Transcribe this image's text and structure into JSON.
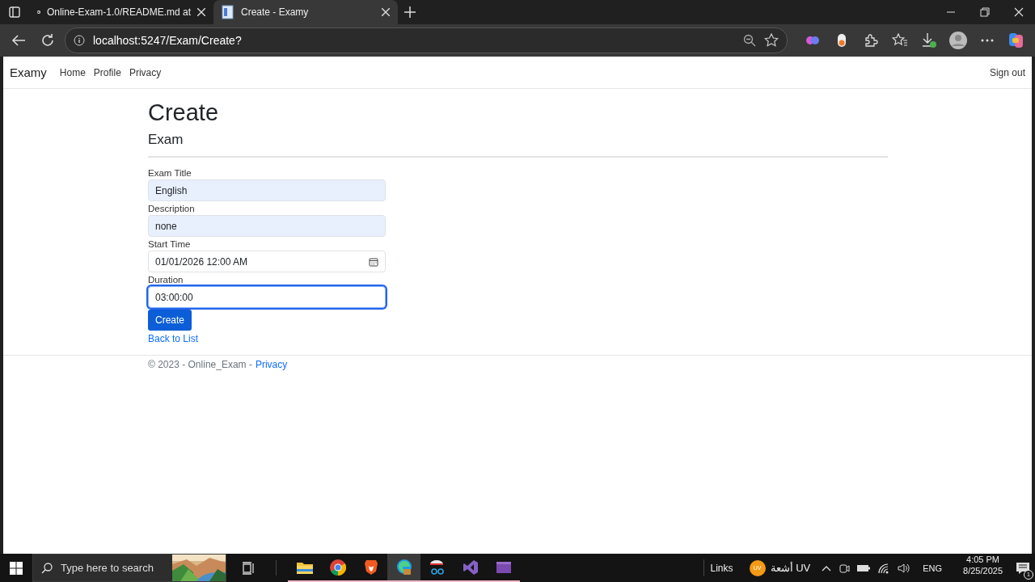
{
  "browser": {
    "tabs": [
      {
        "title": "Online-Exam-1.0/README.md at",
        "selected": false
      },
      {
        "title": "Create - Examy",
        "selected": true
      }
    ],
    "address": "localhost:5247/Exam/Create?"
  },
  "navbar": {
    "brand": "Examy",
    "links": [
      {
        "label": "Home"
      },
      {
        "label": "Profile"
      },
      {
        "label": "Privacy"
      }
    ],
    "sign_out": "Sign out"
  },
  "page": {
    "title": "Create",
    "subtitle": "Exam",
    "fields": [
      {
        "label": "Exam Title",
        "value": "English",
        "kind": "text",
        "autofilled": true,
        "focused": false
      },
      {
        "label": "Description",
        "value": "none",
        "kind": "text",
        "autofilled": true,
        "focused": false
      },
      {
        "label": "Start Time",
        "value": "01/01/2026 12:00  AM",
        "kind": "datetime",
        "autofilled": false,
        "focused": false
      },
      {
        "label": "Duration",
        "value": "03:00:00",
        "kind": "text",
        "autofilled": false,
        "focused": true
      }
    ],
    "submit": "Create",
    "back_link": "Back to List"
  },
  "footer": {
    "text": "© 2023 - Online_Exam -",
    "link": "Privacy"
  },
  "taskbar": {
    "search_placeholder": "Type here to search",
    "apps": [
      {
        "kind": "folder",
        "selected": false
      },
      {
        "kind": "chrome",
        "selected": false
      },
      {
        "kind": "brave",
        "selected": false
      },
      {
        "kind": "edge",
        "selected": true
      },
      {
        "kind": "tool",
        "selected": false
      },
      {
        "kind": "studio",
        "selected": false
      },
      {
        "kind": "purple",
        "selected": false
      }
    ],
    "links_label": "Links",
    "weather_badge": "UV",
    "weather_text": "أشعة UV",
    "language": "ENG",
    "time": "4:05 PM",
    "date": "8/25/2025",
    "notifications": "1"
  }
}
